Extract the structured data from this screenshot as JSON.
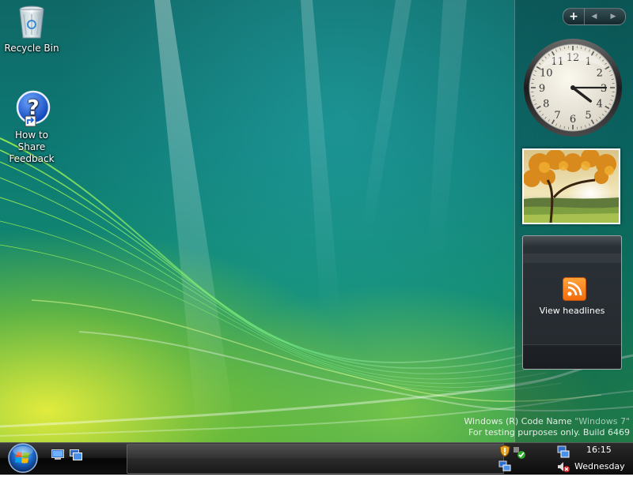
{
  "desktop": {
    "icons": [
      {
        "label": "Recycle Bin",
        "icon": "recycle-bin-icon"
      },
      {
        "label_line1": "How to Share",
        "label_line2": "Feedback",
        "icon": "help-question-icon"
      }
    ]
  },
  "sidebar": {
    "controls": {
      "add": "+",
      "prev": "◀",
      "next": "▶"
    },
    "clock": {
      "time": "16:15",
      "numerals": [
        "12",
        "1",
        "2",
        "3",
        "4",
        "5",
        "6",
        "7",
        "8",
        "9",
        "10",
        "11"
      ]
    },
    "slideshow": {
      "image": "autumn-tree-landscape"
    },
    "feed": {
      "label": "View headlines",
      "icon": "rss-feed-icon"
    }
  },
  "watermark": {
    "line1_prefix": "Windows (R) Code Name ",
    "line1_quoted": "\"Windows 7\"",
    "line2": "For testing purposes only. Build 6469"
  },
  "taskbar": {
    "start": "windows-orb-icon",
    "quick_launch": [
      "show-desktop-icon",
      "switch-windows-icon"
    ],
    "tray": {
      "icons": [
        "windows-defender-icon",
        "security-check-icon",
        "network-icon",
        "volume-muted-icon"
      ],
      "time": "16:15",
      "day": "Wednesday"
    }
  },
  "colors": {
    "rss_orange": "#f26b0c",
    "taskbar": "#101010",
    "wallpaper_teal": "#0e7a74",
    "wallpaper_yellow": "#ebf03c"
  }
}
